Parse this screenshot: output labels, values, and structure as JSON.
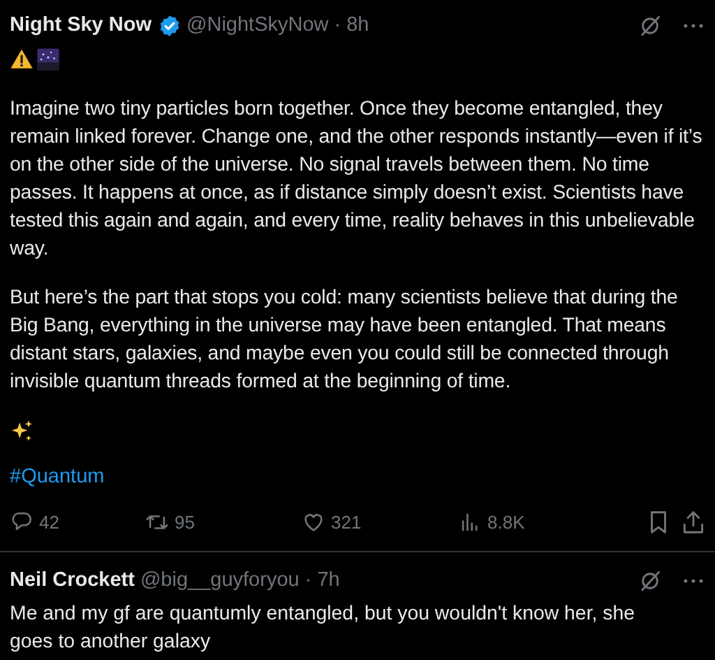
{
  "post": {
    "author": "Night Sky Now",
    "verified": true,
    "handle": "@NightSkyNow",
    "time": "· 8h",
    "paragraphs": [
      "Imagine two tiny particles born together. Once they become entangled, they remain linked forever. Change one, and the other responds instantly—even if it’s on the other side of the universe. No signal travels between them. No time passes. It happens at once, as if distance simply doesn’t exist. Scientists have tested this again and again, and every time, reality behaves in this unbelievable way.",
      "But here’s the part that stops you cold: many scientists believe that during the Big Bang, everything in the universe may have been entangled. That means distant stars, galaxies, and maybe even you could still be connected through invisible quantum threads formed at the beginning of time."
    ],
    "hashtag": "#Quantum",
    "actions": [
      {
        "kind": "reply",
        "count": "42"
      },
      {
        "kind": "repost",
        "count": "95"
      },
      {
        "kind": "like",
        "count": "321"
      },
      {
        "kind": "views",
        "count": "8.8K"
      }
    ]
  },
  "reply": {
    "author": "Neil Crockett",
    "handle": "@big__guyforyou",
    "time": "· 7h",
    "text": "Me and my gf are quantumly entangled, but you wouldn't know her, she goes to another galaxy"
  }
}
